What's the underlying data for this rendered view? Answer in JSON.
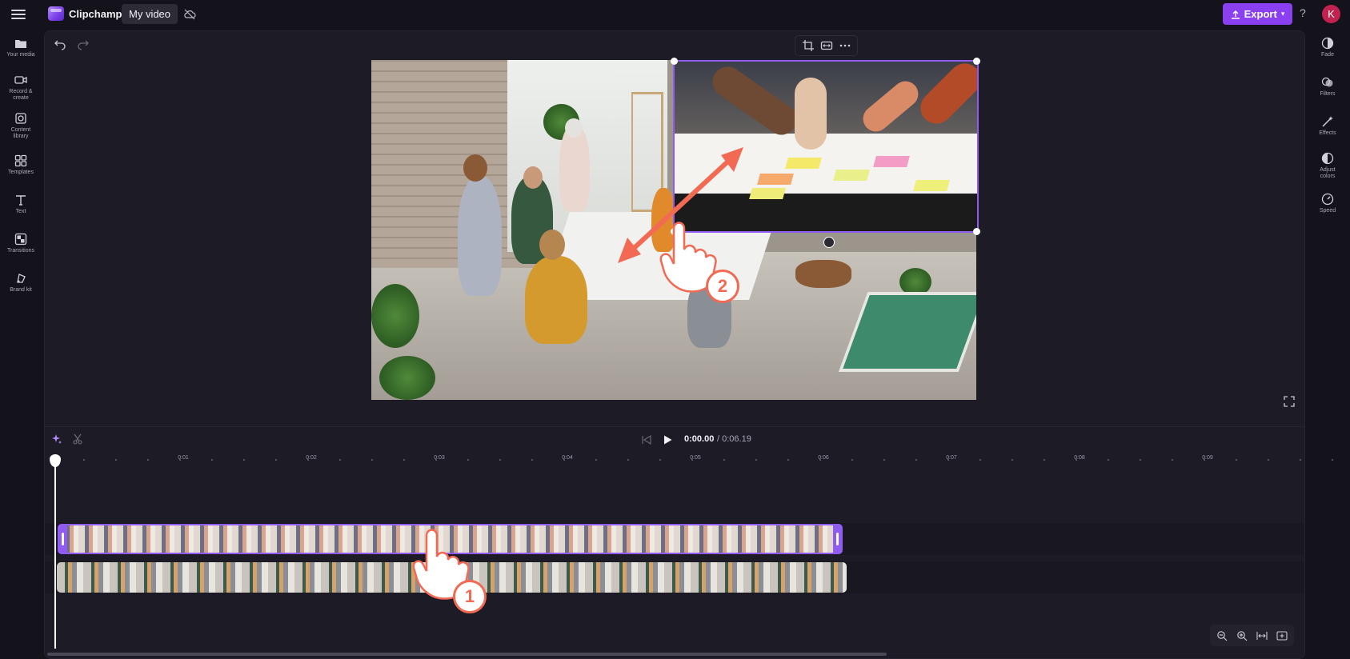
{
  "app": {
    "brand": "Clipchamp",
    "project_title": "My video",
    "export_label": "Export",
    "help_label": "?",
    "avatar_initial": "K"
  },
  "left_rail": [
    {
      "label": "Your media",
      "icon": "folder-icon"
    },
    {
      "label": "Record & create",
      "icon": "camera-icon"
    },
    {
      "label": "Content library",
      "icon": "library-icon"
    },
    {
      "label": "Templates",
      "icon": "templates-icon"
    },
    {
      "label": "Text",
      "icon": "text-icon"
    },
    {
      "label": "Transitions",
      "icon": "transitions-icon"
    },
    {
      "label": "Brand kit",
      "icon": "brand-kit-icon"
    }
  ],
  "right_rail": [
    {
      "label": "Fade",
      "icon": "fade-icon"
    },
    {
      "label": "Filters",
      "icon": "filters-icon"
    },
    {
      "label": "Effects",
      "icon": "effects-icon"
    },
    {
      "label": "Adjust colors",
      "icon": "adjust-colors-icon"
    },
    {
      "label": "Speed",
      "icon": "speed-icon"
    }
  ],
  "playback": {
    "current_time": "0:00.00",
    "total_time": "/ 0:06.19"
  },
  "ruler_labels": [
    "0:01",
    "0:02",
    "0:03",
    "0:04",
    "0:05",
    "0:06",
    "0:07",
    "0:08",
    "0:09"
  ],
  "annotations": {
    "step1": "1",
    "step2": "2"
  },
  "colors": {
    "accent": "#8a3ff0",
    "selection": "#8f5bf0",
    "annotation": "#f26a54",
    "background": "#14131c",
    "panel": "#1c1b26"
  }
}
